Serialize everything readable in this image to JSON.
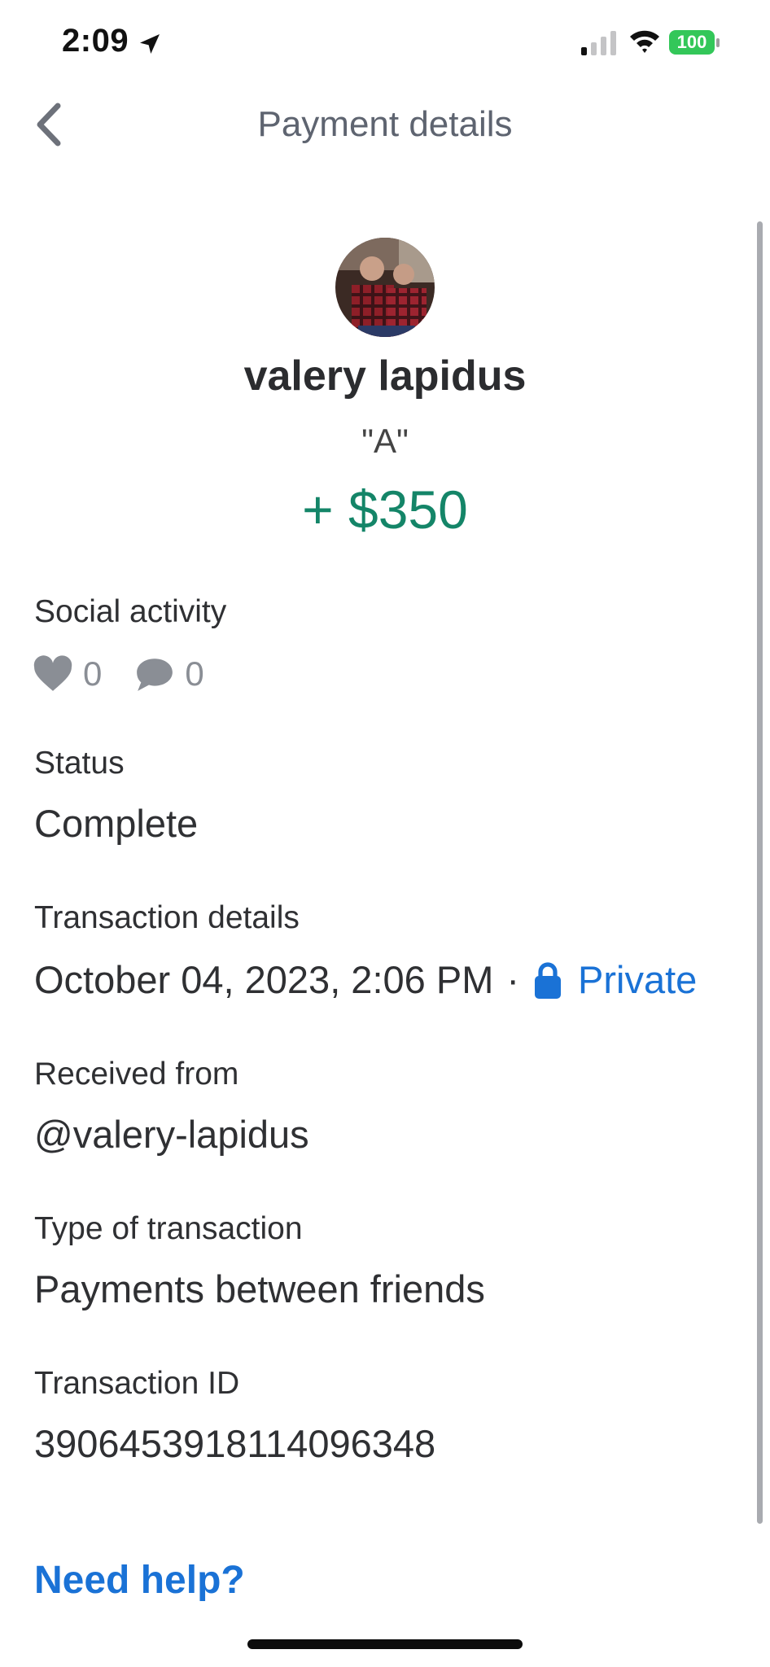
{
  "status_bar": {
    "time": "2:09",
    "battery": "100",
    "location_icon": "location-arrow-icon",
    "signal_icon": "cellular-signal-icon",
    "wifi_icon": "wifi-icon",
    "battery_color": "#33c759"
  },
  "header": {
    "title": "Payment details",
    "back_icon": "chevron-left-icon"
  },
  "payment": {
    "name": "valery lapidus",
    "note": "\"A\"",
    "amount": "+ $350",
    "amount_color": "#148568"
  },
  "social": {
    "label": "Social activity",
    "likes": "0",
    "comments": "0",
    "like_icon": "heart-icon",
    "comment_icon": "comment-bubble-icon"
  },
  "status": {
    "label": "Status",
    "value": "Complete"
  },
  "transaction_details": {
    "label": "Transaction details",
    "datetime": "October 04, 2023, 2:06 PM",
    "separator": "·",
    "privacy": "Private",
    "privacy_icon": "lock-icon",
    "privacy_color": "#1a72d6"
  },
  "received_from": {
    "label": "Received from",
    "value": "@valery-lapidus"
  },
  "transaction_type": {
    "label": "Type of transaction",
    "value": "Payments between friends"
  },
  "transaction_id": {
    "label": "Transaction ID",
    "value": "3906453918114096348"
  },
  "help": {
    "label": "Need help?"
  }
}
